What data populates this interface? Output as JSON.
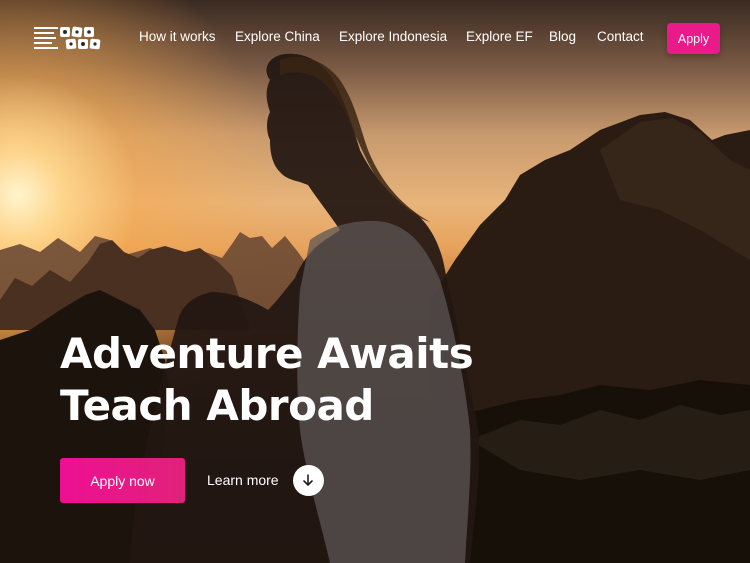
{
  "brand": {
    "logo_text": "EF"
  },
  "nav": {
    "items": [
      {
        "label": "How it works"
      },
      {
        "label": "Explore China"
      },
      {
        "label": "Explore Indonesia"
      },
      {
        "label": "Explore EF"
      },
      {
        "label": "Blog"
      },
      {
        "label": "Contact"
      }
    ],
    "apply_label": "Apply"
  },
  "hero": {
    "headline_line1": "Adventure Awaits",
    "headline_line2": "Teach Abroad",
    "primary_cta": "Apply now",
    "secondary_cta": "Learn more"
  },
  "colors": {
    "accent": "#ea1a8b",
    "text": "#ffffff"
  },
  "icons": {
    "logo": "ef-logo",
    "scroll": "arrow-down-icon"
  }
}
